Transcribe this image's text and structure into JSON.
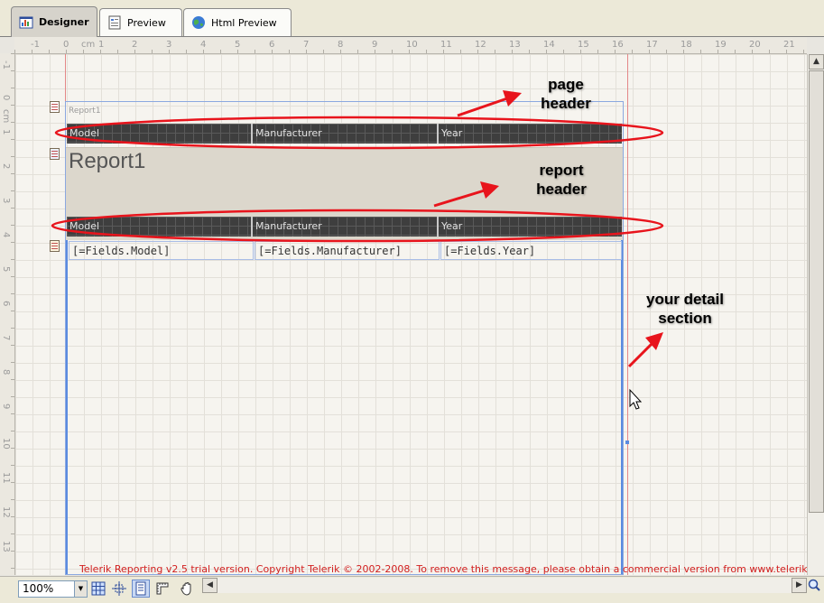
{
  "tabs": [
    {
      "label": "Designer",
      "active": true,
      "icon": "designer-icon"
    },
    {
      "label": "Preview",
      "active": false,
      "icon": "preview-icon"
    },
    {
      "label": "Html Preview",
      "active": false,
      "icon": "globe-icon"
    }
  ],
  "hruler": {
    "labels": [
      "-1",
      "0",
      "cm",
      "1",
      "2",
      "3",
      "4",
      "5",
      "6",
      "7",
      "8",
      "9",
      "10",
      "11",
      "12",
      "13",
      "14",
      "15",
      "16",
      "17",
      "18",
      "19",
      "20",
      "21"
    ]
  },
  "vruler": {
    "labels": [
      "-1",
      "0",
      "cm",
      "1",
      "2",
      "3",
      "4",
      "5",
      "6",
      "7",
      "8",
      "9",
      "10",
      "11",
      "12",
      "13"
    ]
  },
  "report": {
    "name_label": "Report1",
    "title": "Report1",
    "page_header_columns": [
      "Model",
      "Manufacturer",
      "Year"
    ],
    "report_header_columns": [
      "Model",
      "Manufacturer",
      "Year"
    ],
    "detail_fields": [
      "[=Fields.Model]",
      "[=Fields.Manufacturer]",
      "[=Fields.Year]"
    ]
  },
  "annotations": {
    "page_header": "page\nheader",
    "report_header": "report\nheader",
    "detail_section": "your detail\nsection"
  },
  "watermark": "Telerik Reporting v2.5 trial version. Copyright Telerik © 2002-2008. To remove this message, please obtain a commercial version from www.telerik.com",
  "statusbar": {
    "zoom": "100%"
  },
  "colors": {
    "annotation_red": "#e8141c",
    "band_bg": "#3e3e3e",
    "header_fill": "#dcd7cc",
    "selection_blue": "#5b8be0"
  }
}
